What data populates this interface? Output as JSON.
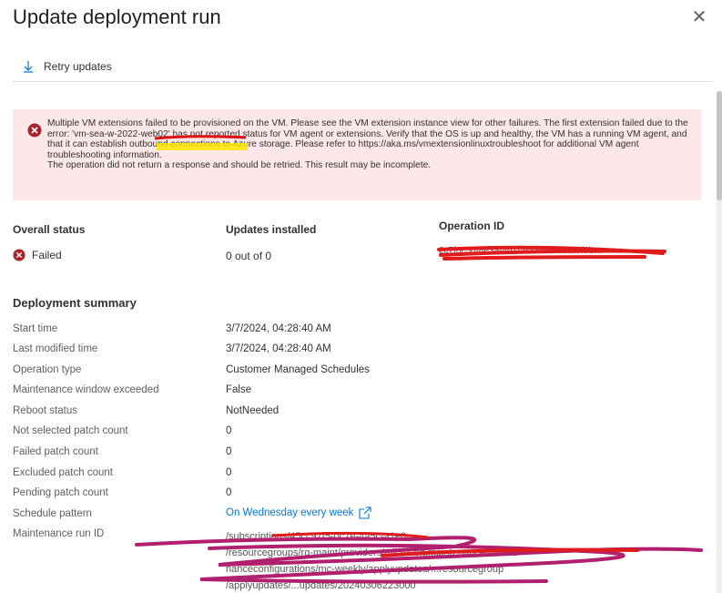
{
  "panel": {
    "title": "Update deployment run"
  },
  "toolbar": {
    "retry_label": "Retry updates"
  },
  "error": {
    "message": "Multiple VM extensions failed to be provisioned on the VM. Please see the VM extension instance view for other failures. The first extension failed due to the error: 'vm-sea-w-2022-web02' has not reported status for VM agent or extensions. Verify that the OS is up and healthy, the VM has a running VM agent, and that it can establish outbound connections to Azure storage. Please refer to https://aka.ms/vmextensionlinuxtroubleshoot for additional VM agent troubleshooting information.",
    "message2": "The operation did not return a response and should be retried. This result may be incomplete."
  },
  "summary_header": {
    "overall_status_label": "Overall status",
    "overall_status_value": "Failed",
    "updates_installed_label": "Updates installed",
    "updates_installed_value": "0 out of 0",
    "operation_id_label": "Operation ID",
    "operation_id_value": "2c7f0c5d-8e3a-4b1f-9a2d-07337c7f9b..."
  },
  "deployment": {
    "title": "Deployment summary",
    "rows": [
      {
        "label": "Start time",
        "value": "3/7/2024, 04:28:40 AM"
      },
      {
        "label": "Last modified time",
        "value": "3/7/2024, 04:28:40 AM"
      },
      {
        "label": "Operation type",
        "value": "Customer Managed Schedules"
      },
      {
        "label": "Maintenance window exceeded",
        "value": "False"
      },
      {
        "label": "Reboot status",
        "value": "NotNeeded"
      },
      {
        "label": "Not selected patch count",
        "value": "0"
      },
      {
        "label": "Failed patch count",
        "value": "0"
      },
      {
        "label": "Excluded patch count",
        "value": "0"
      },
      {
        "label": "Pending patch count",
        "value": "0"
      },
      {
        "label": "Schedule pattern",
        "value": "On Wednesday every week"
      },
      {
        "label": "Maintenance run ID",
        "value": ""
      }
    ],
    "maintenance_run_id_lines": [
      "/subscriptions/45cc97f5-0c7e-4a5c-a1e0-...",
      "/resourcegroups/rg-maint/providers/microsoft.maintenance/mainte",
      "nanceconfigurations/mc-weekly/applyupdates/...resourcegroup",
      "/applyupdates/...updates/20240306223000"
    ]
  },
  "colors": {
    "accent": "#0078d4",
    "error_bg": "#fde7e9",
    "error_icon": "#a4262c"
  }
}
